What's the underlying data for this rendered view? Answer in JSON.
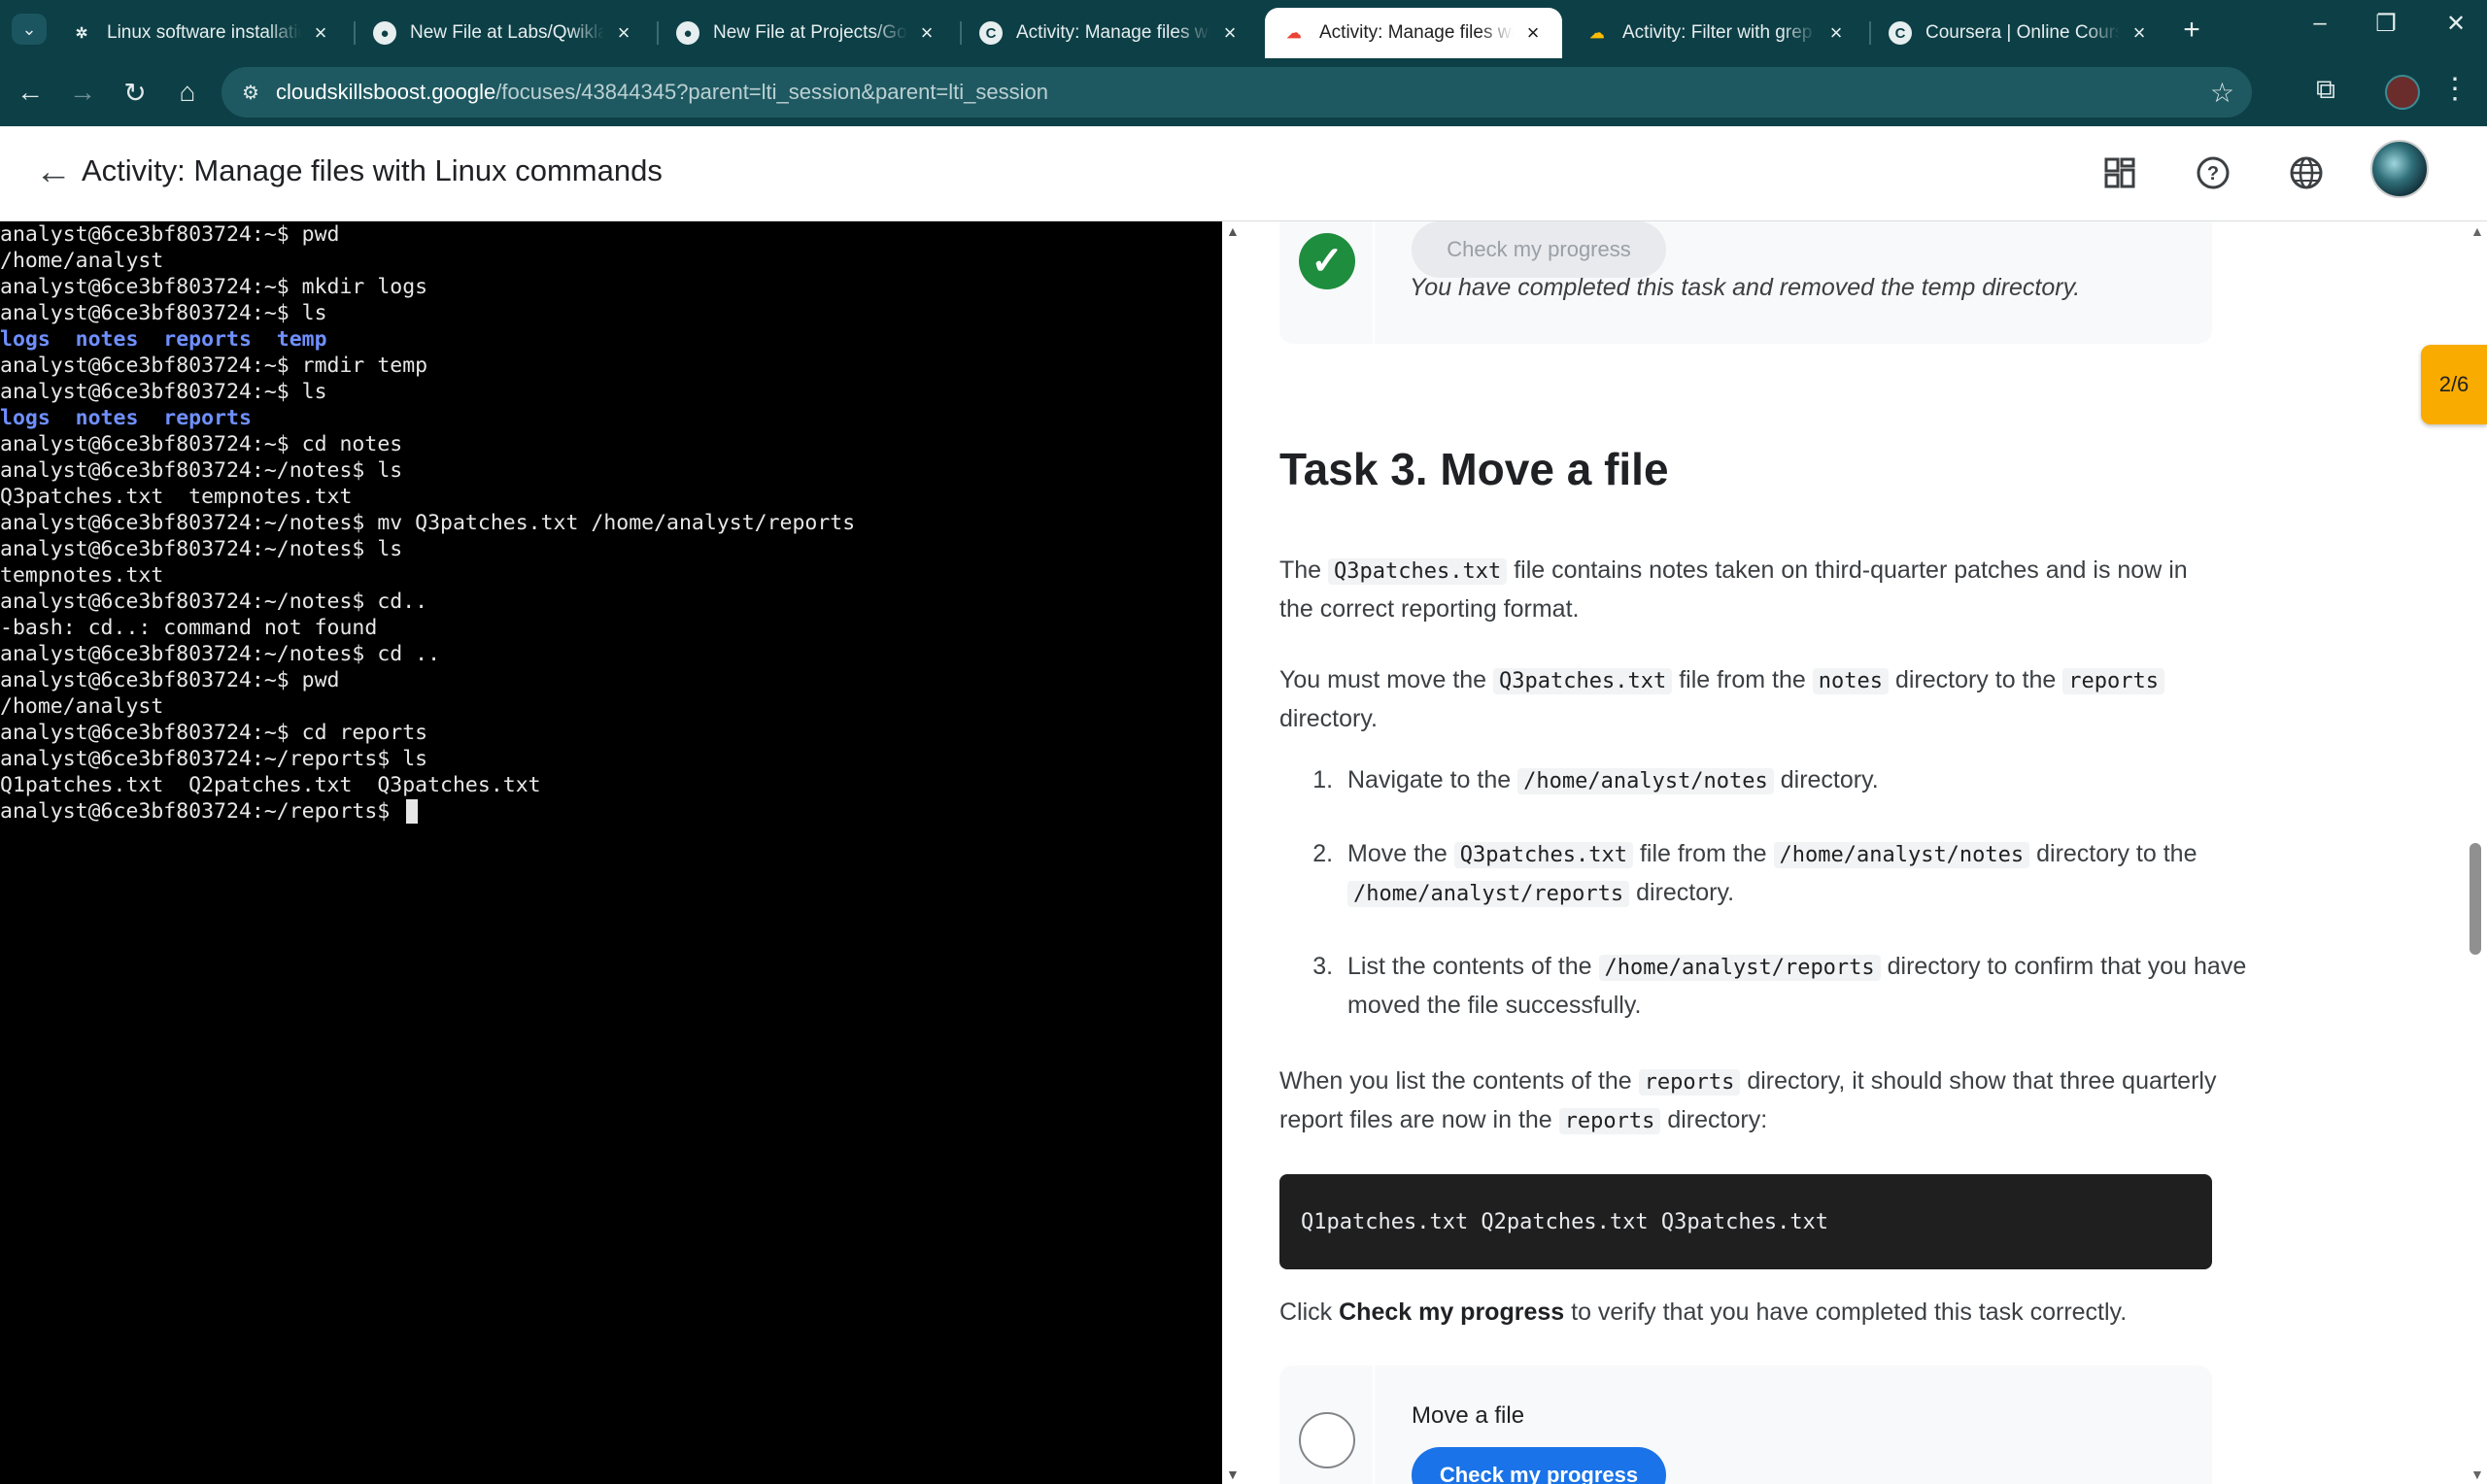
{
  "browser": {
    "tabs": [
      {
        "title": "Linux software installation",
        "favicon": "openai-icon",
        "active": false
      },
      {
        "title": "New File at Labs/Qwiklabs",
        "favicon": "github-icon",
        "active": false
      },
      {
        "title": "New File at Projects/Google",
        "favicon": "github-icon",
        "active": false
      },
      {
        "title": "Activity: Manage files with",
        "favicon": "coursera-icon",
        "active": false
      },
      {
        "title": "Activity: Manage files with",
        "favicon": "google-cloud-icon",
        "active": true
      },
      {
        "title": "Activity: Filter with grep | G",
        "favicon": "google-cloud-icon",
        "active": false
      },
      {
        "title": "Coursera | Online Courses",
        "favicon": "coursera-icon",
        "active": false
      }
    ],
    "url_domain": "cloudskillsboost.google",
    "url_path": "/focuses/43844345?parent=lti_session&parent=lti_session"
  },
  "header": {
    "title": "Activity: Manage files with Linux commands"
  },
  "terminal": {
    "lines": [
      {
        "text": "analyst@6ce3bf803724:~$ pwd"
      },
      {
        "text": "/home/analyst"
      },
      {
        "text": "analyst@6ce3bf803724:~$ mkdir logs"
      },
      {
        "text": "analyst@6ce3bf803724:~$ ls"
      },
      {
        "dirs": [
          "logs",
          "notes",
          "reports",
          "temp"
        ]
      },
      {
        "text": "analyst@6ce3bf803724:~$ rmdir temp"
      },
      {
        "text": "analyst@6ce3bf803724:~$ ls"
      },
      {
        "dirs": [
          "logs",
          "notes",
          "reports"
        ]
      },
      {
        "text": "analyst@6ce3bf803724:~$ cd notes"
      },
      {
        "text": "analyst@6ce3bf803724:~/notes$ ls"
      },
      {
        "text": "Q3patches.txt  tempnotes.txt"
      },
      {
        "text": "analyst@6ce3bf803724:~/notes$ mv Q3patches.txt /home/analyst/reports"
      },
      {
        "text": "analyst@6ce3bf803724:~/notes$ ls"
      },
      {
        "text": "tempnotes.txt"
      },
      {
        "text": "analyst@6ce3bf803724:~/notes$ cd.."
      },
      {
        "text": "-bash: cd..: command not found"
      },
      {
        "text": "analyst@6ce3bf803724:~/notes$ cd .."
      },
      {
        "text": "analyst@6ce3bf803724:~$ pwd"
      },
      {
        "text": "/home/analyst"
      },
      {
        "text": "analyst@6ce3bf803724:~$ cd reports"
      },
      {
        "text": "analyst@6ce3bf803724:~/reports$ ls"
      },
      {
        "text": "Q1patches.txt  Q2patches.txt  Q3patches.txt"
      },
      {
        "text": "analyst@6ce3bf803724:~/reports$ ",
        "cursor": true
      }
    ]
  },
  "content": {
    "progress_badge": "2/6",
    "prev_card": {
      "button": "Check my progress",
      "message": "You have completed this task and removed the temp directory."
    },
    "task_heading": "Task 3. Move a file",
    "intro": {
      "p1": {
        "a": "The",
        "code1": "Q3patches.txt",
        "b": "file contains notes taken on third-quarter patches and is now in the correct reporting format."
      },
      "p2": {
        "a": "You must move the",
        "code1": "Q3patches.txt",
        "b": "file from the",
        "code2": "notes",
        "c": "directory to the",
        "code3": "reports",
        "d": "directory."
      }
    },
    "steps": [
      {
        "a": "Navigate to the",
        "code1": "/home/analyst/notes",
        "b": "directory."
      },
      {
        "a": "Move the",
        "code1": "Q3patches.txt",
        "b": "file from the",
        "code2": "/home/analyst/notes",
        "c": "directory to the",
        "code3": "/home/analyst/reports",
        "d": "directory."
      },
      {
        "a": "List the contents of the",
        "code1": "/home/analyst/reports",
        "b": "directory to confirm that you have moved the file successfully."
      }
    ],
    "result_para": {
      "a": "When you list the contents of the",
      "code1": "reports",
      "b": "directory, it should show that three quarterly report files are now in the",
      "code2": "reports",
      "c": "directory:"
    },
    "code_block": "Q1patches.txt Q2patches.txt Q3patches.txt",
    "click_para": {
      "a": "Click",
      "bold": "Check my progress",
      "b": "to verify that you have completed this task correctly."
    },
    "task_card": {
      "title": "Move a file",
      "button": "Check my progress"
    }
  }
}
